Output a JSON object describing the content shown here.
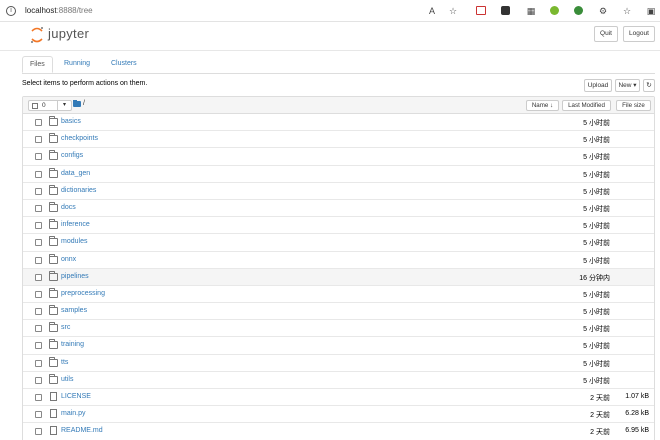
{
  "browser": {
    "url_host": "localhost",
    "url_rest": ":8888/tree"
  },
  "header": {
    "logo_text": "jupyter",
    "quit_label": "Quit",
    "logout_label": "Logout"
  },
  "tabs": [
    {
      "label": "Files",
      "active": true
    },
    {
      "label": "Running",
      "active": false
    },
    {
      "label": "Clusters",
      "active": false
    }
  ],
  "toolbar": {
    "hint": "Select items to perform actions on them.",
    "upload_label": "Upload",
    "new_label": "New ▾",
    "refresh_icon": "↻"
  },
  "list_header": {
    "selected_count": "0",
    "breadcrumb": "/",
    "name_label": "Name ↓",
    "last_modified_label": "Last Modified",
    "file_size_label": "File size"
  },
  "files": [
    {
      "name": "basics",
      "type": "folder",
      "modified": "5 小时前",
      "size": ""
    },
    {
      "name": "checkpoints",
      "type": "folder",
      "modified": "5 小时前",
      "size": ""
    },
    {
      "name": "configs",
      "type": "folder",
      "modified": "5 小时前",
      "size": ""
    },
    {
      "name": "data_gen",
      "type": "folder",
      "modified": "5 小时前",
      "size": ""
    },
    {
      "name": "dictionaries",
      "type": "folder",
      "modified": "5 小时前",
      "size": ""
    },
    {
      "name": "docs",
      "type": "folder",
      "modified": "5 小时前",
      "size": ""
    },
    {
      "name": "inference",
      "type": "folder",
      "modified": "5 小时前",
      "size": ""
    },
    {
      "name": "modules",
      "type": "folder",
      "modified": "5 小时前",
      "size": ""
    },
    {
      "name": "onnx",
      "type": "folder",
      "modified": "5 小时前",
      "size": ""
    },
    {
      "name": "pipelines",
      "type": "folder",
      "modified": "16 分钟内",
      "size": "",
      "highlight": true
    },
    {
      "name": "preprocessing",
      "type": "folder",
      "modified": "5 小时前",
      "size": ""
    },
    {
      "name": "samples",
      "type": "folder",
      "modified": "5 小时前",
      "size": ""
    },
    {
      "name": "src",
      "type": "folder",
      "modified": "5 小时前",
      "size": ""
    },
    {
      "name": "training",
      "type": "folder",
      "modified": "5 小时前",
      "size": ""
    },
    {
      "name": "tts",
      "type": "folder",
      "modified": "5 小时前",
      "size": ""
    },
    {
      "name": "utils",
      "type": "folder",
      "modified": "5 小时前",
      "size": ""
    },
    {
      "name": "LICENSE",
      "type": "file",
      "modified": "2 天前",
      "size": "1.07 kB"
    },
    {
      "name": "main.py",
      "type": "file",
      "modified": "2 天前",
      "size": "6.28 kB"
    },
    {
      "name": "README.md",
      "type": "file",
      "modified": "2 天前",
      "size": "6.95 kB"
    }
  ]
}
